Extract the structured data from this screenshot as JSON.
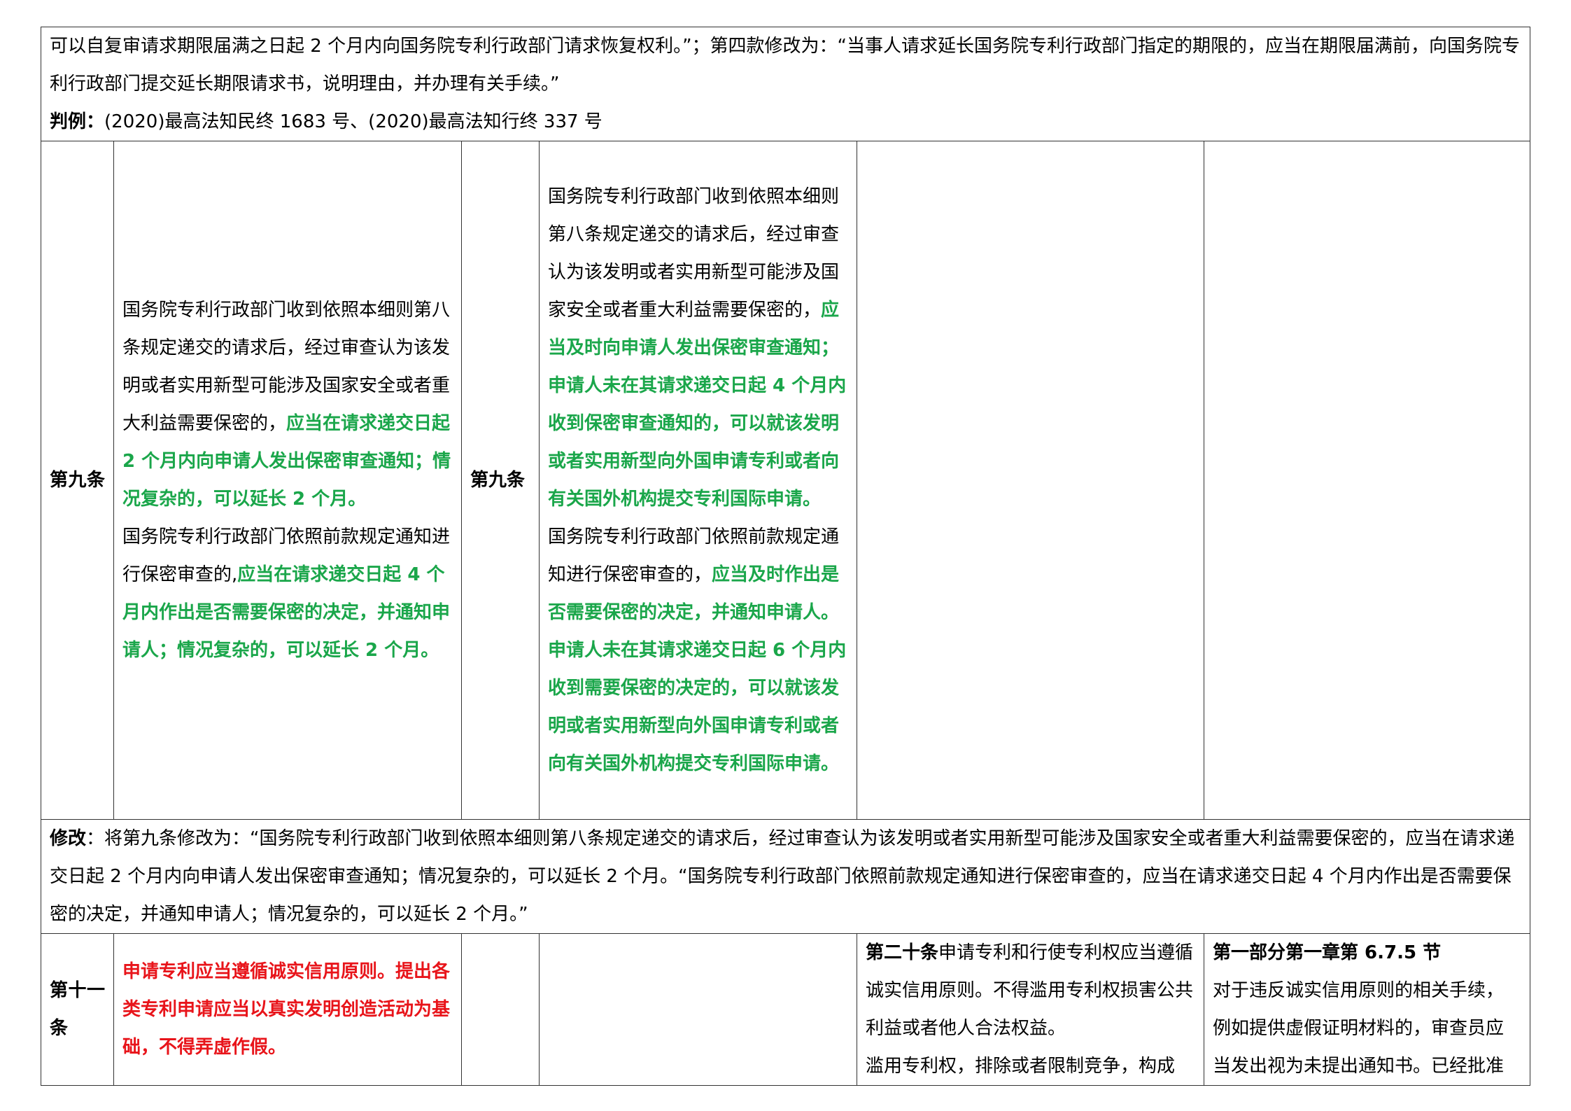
{
  "top_row": {
    "text": "可以自复审请求期限届满之日起 2 个月内向国务院专利行政部门请求恢复权利。”；第四款修改为：“当事人请求延长国务院专利行政部门指定的期限的，应当在期限届满前，向国务院专利行政部门提交延长期限请求书，说明理由，并办理有关手续。”",
    "case_label": "判例",
    "case_colon": "：",
    "case_text": "(2020)最高法知民终 1683 号、(2020)最高法知行终 337 号"
  },
  "article9": {
    "label": "第九条",
    "old": {
      "p1_plain": "国务院专利行政部门收到依照本细则第八条规定递交的请求后，经过审查认为该发明或者实用新型可能涉及国家安全或者重大利益需要保密的，",
      "p1_green": "应当在请求递交日起 2 个月内向申请人发出保密审查通知；情况复杂的，可以延长 2 个月。",
      "p2_plain": "国务院专利行政部门依照前款规定通知进行保密审查的,",
      "p2_green": "应当在请求递交日起 4 个月内作出是否需要保密的决定，并通知申请人；情况复杂的，可以延长 2 个月。"
    },
    "new_label": "第九条",
    "new": {
      "p1_plain": "国务院专利行政部门收到依照本细则第八条规定递交的请求后，经过审查认为该发明或者实用新型可能涉及国家安全或者重大利益需要保密的，",
      "p1_green": "应当及时向申请人发出保密审查通知；申请人未在其请求递交日起 4 个月内收到保密审查通知的，可以就该发明或者实用新型向外国申请专利或者向有关国外机构提交专利国际申请。",
      "p2_plain": "国务院专利行政部门依照前款规定通知进行保密审查的，",
      "p2_green": "应当及时作出是否需要保密的决定，并通知申请人。申请人未在其请求递交日起 6 个月内收到需要保密的决定的，可以就该发明或者实用新型向外国申请专利或者向有关国外机构提交专利国际申请。"
    }
  },
  "modify_row": {
    "label": "修改",
    "colon": "：",
    "text": "将第九条修改为：“国务院专利行政部门收到依照本细则第八条规定递交的请求后，经过审查认为该发明或者实用新型可能涉及国家安全或者重大利益需要保密的，应当在请求递交日起 2 个月内向申请人发出保密审查通知；情况复杂的，可以延长 2 个月。“国务院专利行政部门依照前款规定通知进行保密审查的，应当在请求递交日起 4 个月内作出是否需要保密的决定，并通知申请人；情况复杂的，可以延长 2 个月。”"
  },
  "article11": {
    "label": "第十一条",
    "old_red": "申请专利应当遵循诚实信用原则。提出各类专利申请应当以真实发明创造活动为基础，不得弄虚作假。",
    "law_bold": "第二十条",
    "law_p1": "申请专利和行使专利权应当遵循诚实信用原则。不得滥用专利权损害公共利益或者他人合法权益。",
    "law_p2": "滥用专利权，排除或者限制竞争，构成",
    "guide_bold": "第一部分第一章第 6.7.5 节",
    "guide_text": "对于违反诚实信用原则的相关手续，例如提供虚假证明材料的，审查员应当发出视为未提出通知书。已经批准"
  }
}
